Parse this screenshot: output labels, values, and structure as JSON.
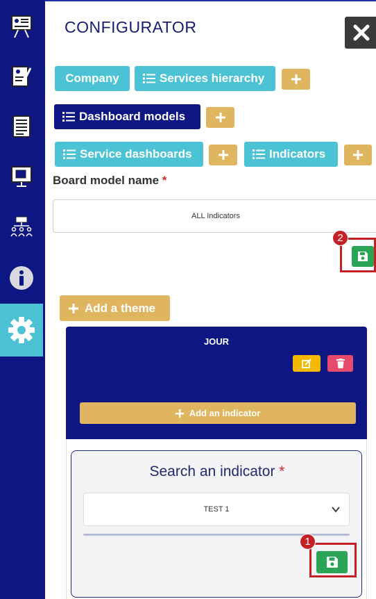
{
  "sidebar": {
    "items": [
      {
        "icon": "presentation-board-icon"
      },
      {
        "icon": "document-signature-icon"
      },
      {
        "icon": "report-document-icon"
      },
      {
        "icon": "monitor-slides-icon"
      },
      {
        "icon": "org-chart-icon"
      },
      {
        "icon": "info-icon"
      },
      {
        "icon": "gear-icon",
        "active": true
      }
    ]
  },
  "header": {
    "title": "CONFIGURATOR",
    "close_icon": "close-icon"
  },
  "nav": {
    "company": "Company",
    "services_hierarchy": "Services hierarchy",
    "dashboard_models": "Dashboard models",
    "service_dashboards": "Service dashboards",
    "indicators": "Indicators"
  },
  "form": {
    "label": "Board model name",
    "required_mark": "*",
    "value": "ALL Indicators"
  },
  "markers": {
    "first": "1",
    "second": "2"
  },
  "theme": {
    "add_label": "Add a theme",
    "title": "JOUR",
    "add_indicator_label": "Add an indicator"
  },
  "search": {
    "title": "Search an indicator",
    "required_mark": "*",
    "selected": "TEST 1"
  },
  "colors": {
    "navy": "#0d1683",
    "teal": "#4cc3d4",
    "gold": "#e0b560",
    "green": "#2aa556",
    "highlight_red": "#c42126"
  }
}
